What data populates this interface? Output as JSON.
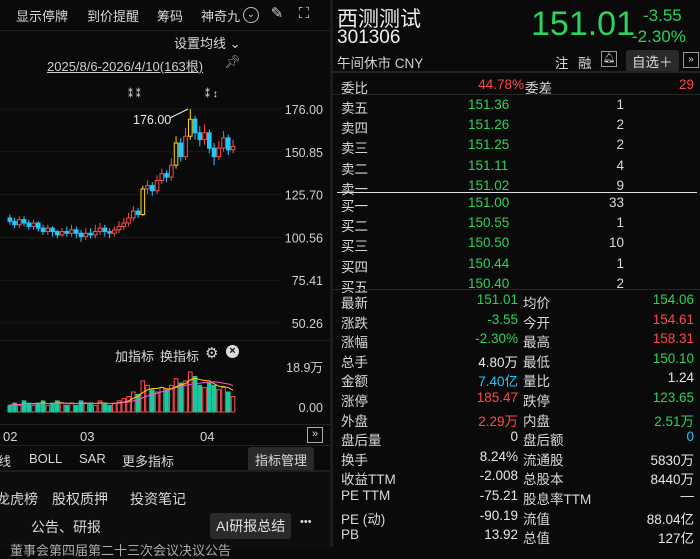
{
  "toolbar": {
    "show_suspended": "显示停牌",
    "price_alert": "到价提醒",
    "chip": "筹码",
    "shenqi": "神奇九"
  },
  "chart": {
    "settings_label": "设置均线",
    "range_label": "2025/8/6-2026/4/10(163根)",
    "high_label": "176.00",
    "price_axis": [
      "176.00",
      "150.85",
      "125.70",
      "100.56",
      "75.41",
      "50.26"
    ],
    "indicator_add": "加指标",
    "indicator_swap": "换指标",
    "vol_axis": [
      "18.9万",
      "0.00"
    ],
    "months": [
      "02",
      "03",
      "04"
    ]
  },
  "candles": [
    {
      "o": 112,
      "c": 110,
      "h": 114,
      "l": 108
    },
    {
      "o": 110,
      "c": 108,
      "h": 112,
      "l": 106
    },
    {
      "o": 108,
      "c": 111,
      "h": 113,
      "l": 106
    },
    {
      "o": 111,
      "c": 109,
      "h": 113,
      "l": 107
    },
    {
      "o": 109,
      "c": 107,
      "h": 111,
      "l": 105
    },
    {
      "o": 107,
      "c": 109,
      "h": 111,
      "l": 105
    },
    {
      "o": 109,
      "c": 106,
      "h": 110,
      "l": 104
    },
    {
      "o": 106,
      "c": 104,
      "h": 108,
      "l": 102
    },
    {
      "o": 104,
      "c": 106,
      "h": 108,
      "l": 102
    },
    {
      "o": 106,
      "c": 104,
      "h": 107,
      "l": 101
    },
    {
      "o": 104,
      "c": 102,
      "h": 105,
      "l": 100
    },
    {
      "o": 102,
      "c": 104,
      "h": 106,
      "l": 101
    },
    {
      "o": 104,
      "c": 103,
      "h": 107,
      "l": 101
    },
    {
      "o": 103,
      "c": 105,
      "h": 108,
      "l": 101
    },
    {
      "o": 105,
      "c": 103,
      "h": 107,
      "l": 100
    },
    {
      "o": 103,
      "c": 101,
      "h": 105,
      "l": 98
    },
    {
      "o": 101,
      "c": 103,
      "h": 106,
      "l": 99
    },
    {
      "o": 103,
      "c": 102,
      "h": 106,
      "l": 100
    },
    {
      "o": 102,
      "c": 104,
      "h": 108,
      "l": 100
    },
    {
      "o": 104,
      "c": 106,
      "h": 109,
      "l": 102
    },
    {
      "o": 106,
      "c": 104,
      "h": 108,
      "l": 101
    },
    {
      "o": 104,
      "c": 103,
      "h": 106,
      "l": 100
    },
    {
      "o": 103,
      "c": 105,
      "h": 107,
      "l": 101
    },
    {
      "o": 105,
      "c": 107,
      "h": 110,
      "l": 103
    },
    {
      "o": 107,
      "c": 109,
      "h": 112,
      "l": 105
    },
    {
      "o": 109,
      "c": 112,
      "h": 115,
      "l": 107
    },
    {
      "o": 112,
      "c": 116,
      "h": 119,
      "l": 110
    },
    {
      "o": 116,
      "c": 114,
      "h": 118,
      "l": 112
    },
    {
      "o": 114,
      "c": 129,
      "h": 131,
      "l": 113
    },
    {
      "o": 129,
      "c": 131,
      "h": 134,
      "l": 126
    },
    {
      "o": 131,
      "c": 128,
      "h": 133,
      "l": 125
    },
    {
      "o": 128,
      "c": 134,
      "h": 137,
      "l": 126
    },
    {
      "o": 134,
      "c": 138,
      "h": 141,
      "l": 132
    },
    {
      "o": 138,
      "c": 136,
      "h": 140,
      "l": 133
    },
    {
      "o": 136,
      "c": 143,
      "h": 147,
      "l": 134
    },
    {
      "o": 143,
      "c": 156,
      "h": 160,
      "l": 141
    },
    {
      "o": 156,
      "c": 148,
      "h": 159,
      "l": 145
    },
    {
      "o": 148,
      "c": 160,
      "h": 165,
      "l": 146
    },
    {
      "o": 160,
      "c": 170,
      "h": 176,
      "l": 158
    },
    {
      "o": 170,
      "c": 162,
      "h": 172,
      "l": 158
    },
    {
      "o": 162,
      "c": 158,
      "h": 166,
      "l": 154
    },
    {
      "o": 158,
      "c": 162,
      "h": 167,
      "l": 155
    },
    {
      "o": 162,
      "c": 153,
      "h": 164,
      "l": 150
    },
    {
      "o": 153,
      "c": 148,
      "h": 156,
      "l": 143
    },
    {
      "o": 148,
      "c": 153,
      "h": 157,
      "l": 146
    },
    {
      "o": 153,
      "c": 159,
      "h": 163,
      "l": 151
    },
    {
      "o": 159,
      "c": 152,
      "h": 161,
      "l": 149
    },
    {
      "o": 152,
      "c": 154,
      "h": 158,
      "l": 150
    }
  ],
  "volumes": [
    3,
    4,
    3,
    5,
    4,
    3,
    4,
    5,
    3,
    4,
    5,
    4,
    3,
    4,
    3,
    5,
    4,
    4,
    3,
    5,
    4,
    3,
    4,
    5,
    6,
    7,
    9,
    8,
    14,
    12,
    10,
    9,
    11,
    10,
    12,
    15,
    13,
    14,
    18,
    16,
    12,
    11,
    13,
    12,
    10,
    11,
    9,
    7
  ],
  "bottom_bar": {
    "items": [
      "线",
      "BOLL",
      "SAR",
      "更多指标"
    ],
    "manage": "指标管理",
    "tabs": [
      "龙虎榜",
      "股权质押",
      "投资笔记"
    ],
    "announce": "公告、研报",
    "ai_summary": "AI研报总结",
    "more": "•••",
    "ticker_text": "董事会第四届第二十三次会议决议公告"
  },
  "stock": {
    "name": "西测测试",
    "code": "301306",
    "status": "午间休市 CNY",
    "price": "151.01",
    "change": "-3.55",
    "change_pct": "-2.30%",
    "flag_zhu": "注",
    "flag_rong": "融",
    "watch_label": "自选＋"
  },
  "committee": {
    "ratio_label": "委比",
    "ratio": "44.78%",
    "diff_label": "委差",
    "diff": "29"
  },
  "asks": [
    {
      "label": "卖五",
      "price": "151.36",
      "vol": "1"
    },
    {
      "label": "卖四",
      "price": "151.26",
      "vol": "2"
    },
    {
      "label": "卖三",
      "price": "151.25",
      "vol": "2"
    },
    {
      "label": "卖二",
      "price": "151.11",
      "vol": "4"
    },
    {
      "label": "卖一",
      "price": "151.02",
      "vol": "9"
    }
  ],
  "bids": [
    {
      "label": "买一",
      "price": "151.00",
      "vol": "33"
    },
    {
      "label": "买二",
      "price": "150.55",
      "vol": "1"
    },
    {
      "label": "买三",
      "price": "150.50",
      "vol": "10"
    },
    {
      "label": "买四",
      "price": "150.44",
      "vol": "1"
    },
    {
      "label": "买五",
      "price": "150.40",
      "vol": "2"
    }
  ],
  "stats": [
    {
      "l1": "最新",
      "v1": "151.01",
      "c1": "green",
      "l2": "均价",
      "v2": "154.06",
      "c2": "green"
    },
    {
      "l1": "涨跌",
      "v1": "-3.55",
      "c1": "green",
      "l2": "今开",
      "v2": "154.61",
      "c2": "red"
    },
    {
      "l1": "涨幅",
      "v1": "-2.30%",
      "c1": "green",
      "l2": "最高",
      "v2": "158.31",
      "c2": "red"
    },
    {
      "l1": "总手",
      "v1": "4.80万",
      "c1": "white",
      "l2": "最低",
      "v2": "150.10",
      "c2": "green"
    },
    {
      "l1": "金额",
      "v1": "7.40亿",
      "c1": "cyan",
      "l2": "量比",
      "v2": "1.24",
      "c2": "white"
    },
    {
      "l1": "涨停",
      "v1": "185.47",
      "c1": "red",
      "l2": "跌停",
      "v2": "123.65",
      "c2": "green"
    },
    {
      "l1": "外盘",
      "v1": "2.29万",
      "c1": "red",
      "l2": "内盘",
      "v2": "2.51万",
      "c2": "green"
    },
    {
      "l1": "盘后量",
      "v1": "0",
      "c1": "white",
      "l2": "盘后额",
      "v2": "0",
      "c2": "cyan"
    },
    {
      "l1": "换手",
      "v1": "8.24%",
      "c1": "white",
      "l2": "流通股",
      "v2": "5830万",
      "c2": "white"
    },
    {
      "l1": "收益TTM",
      "v1": "-2.008",
      "c1": "white",
      "l2": "总股本",
      "v2": "8440万",
      "c2": "white"
    },
    {
      "l1": "PE TTM",
      "v1": "-75.21",
      "c1": "white",
      "l2": "股息率TTM",
      "v2": "—",
      "c2": "white"
    },
    {
      "l1": "PE (动)",
      "v1": "-90.19",
      "c1": "white",
      "l2": "流值",
      "v2": "88.04亿",
      "c2": "white"
    },
    {
      "l1": "PB",
      "v1": "13.92",
      "c1": "white",
      "l2": "总值",
      "v2": "127亿",
      "c2": "white"
    }
  ],
  "colors": {
    "up": "#ff4a4a",
    "down": "#2dd35a",
    "flat": "#d8d8d8",
    "amount": "#1ec8ff"
  }
}
